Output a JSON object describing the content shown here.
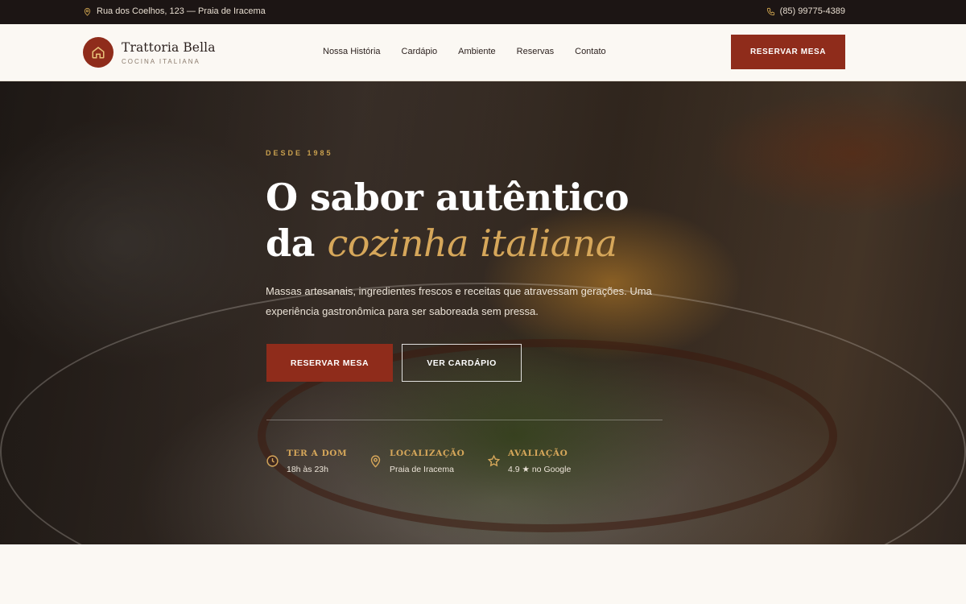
{
  "topbar": {
    "address": "Rua dos Coelhos, 123 — Praia de Iracema",
    "phone": "(85) 99775-4389"
  },
  "header": {
    "brand_name": "Trattoria Bella",
    "brand_tagline": "COCINA ITALIANA",
    "nav": [
      "Nossa História",
      "Cardápio",
      "Ambiente",
      "Reservas",
      "Contato"
    ],
    "cta_label": "RESERVAR MESA"
  },
  "hero": {
    "eyebrow": "DESDE 1985",
    "title_line1": "O sabor autêntico",
    "title_line2_prefix": "da ",
    "title_line2_accent": "cozinha italiana",
    "description": "Massas artesanais, ingredientes frescos e receitas que atravessam gerações. Uma experiência gastronômica para ser saboreada sem pressa.",
    "primary_button": "RESERVAR MESA",
    "secondary_button": "VER CARDÁPIO",
    "info": [
      {
        "icon": "clock-icon",
        "label": "TER A DOM",
        "value": "18h às 23h"
      },
      {
        "icon": "map-pin-icon",
        "label": "LOCALIZAÇÃO",
        "value": "Praia de Iracema"
      },
      {
        "icon": "star-icon",
        "label": "AVALIAÇÃO",
        "value": "4.9 ★ no Google"
      }
    ]
  },
  "colors": {
    "brand": "#8f2c1b",
    "gold": "#d6a75a",
    "topbar_bg": "#1c1514",
    "page_bg": "#fbf8f3"
  }
}
